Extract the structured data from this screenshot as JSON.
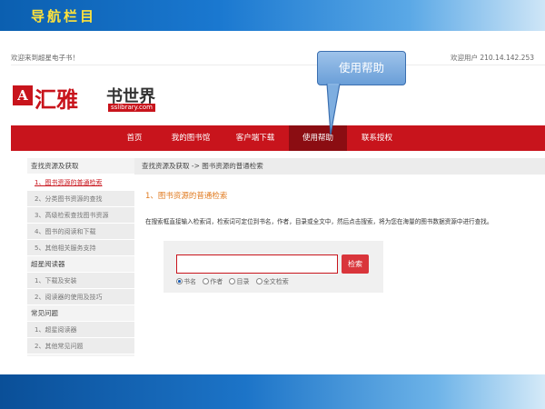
{
  "slide": {
    "title": "导航栏目"
  },
  "topbar": {
    "welcome": "欢迎来到超星电子书！",
    "user": "欢迎用户 210.14.142.253"
  },
  "logo": {
    "mark": "A",
    "brand": "汇雅",
    "sub": "书世界",
    "domain": "sslibrary.com"
  },
  "nav": {
    "items": [
      {
        "label": "首页"
      },
      {
        "label": "我的图书馆"
      },
      {
        "label": "客户端下载"
      },
      {
        "label": "使用帮助",
        "active": true
      },
      {
        "label": "联系授权"
      }
    ]
  },
  "callout": {
    "text": "使用帮助"
  },
  "sidebar": {
    "items": [
      {
        "label": "查找资源及获取",
        "type": "head"
      },
      {
        "label": "1、图书资源的普通检索",
        "type": "item",
        "active": true
      },
      {
        "label": "2、分类图书资源的查找",
        "type": "item"
      },
      {
        "label": "3、高级检索查找图书资源",
        "type": "item"
      },
      {
        "label": "4、图书的阅读和下载",
        "type": "item"
      },
      {
        "label": "5、其他相关服务支持",
        "type": "item"
      },
      {
        "label": "超星阅读器",
        "type": "head"
      },
      {
        "label": "1、下载及安装",
        "type": "item"
      },
      {
        "label": "2、阅读器的使用及技巧",
        "type": "item"
      },
      {
        "label": "常见问题",
        "type": "head"
      },
      {
        "label": "1、超星阅读器",
        "type": "item"
      },
      {
        "label": "2、其他常见问题",
        "type": "item"
      }
    ]
  },
  "main": {
    "breadcrumb": "查找资源及获取 -> 图书资源的普通检索",
    "section_title": "1、图书资源的普通检索",
    "description": "在搜索框直接输入检索词，检索词可定位到书名，作者，目录或全文中，然后点击搜索，将为您在海量的图书数据资源中进行查找。",
    "search": {
      "value": "",
      "button": "检索",
      "options": [
        {
          "label": "书名",
          "checked": true
        },
        {
          "label": "作者",
          "checked": false
        },
        {
          "label": "目录",
          "checked": false
        },
        {
          "label": "全文检索",
          "checked": false
        }
      ]
    }
  },
  "colors": {
    "brand_red": "#c8141c",
    "active_nav": "#8b0d12",
    "title_yellow": "#ffe23a",
    "section_orange": "#e07a1f"
  }
}
